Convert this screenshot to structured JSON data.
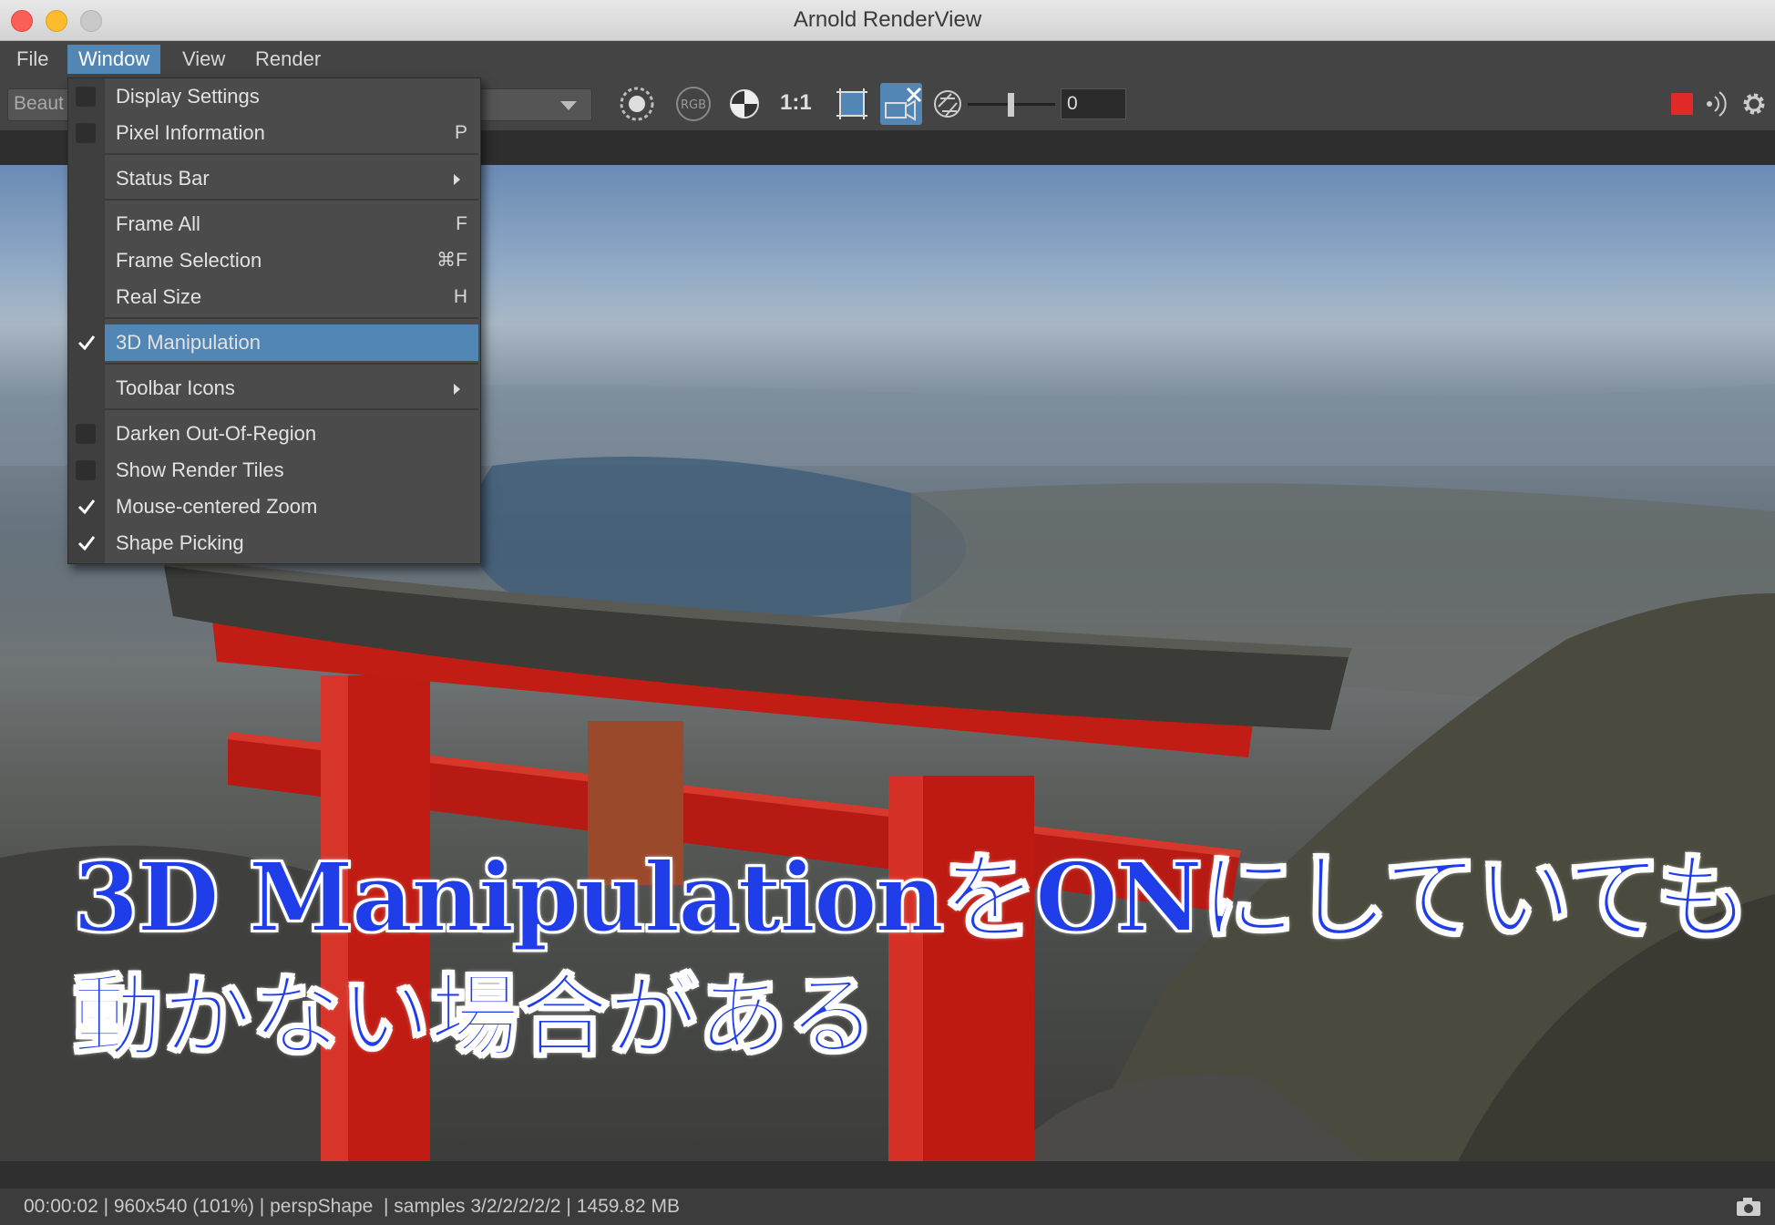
{
  "window": {
    "title": "Arnold RenderView"
  },
  "menubar": {
    "items": [
      "File",
      "Window",
      "View",
      "Render"
    ],
    "active": "Window"
  },
  "toolbar": {
    "aov_value": "Beaut",
    "one_to_one": "1:1",
    "frame_value": "0",
    "rgb_label": "RGB"
  },
  "dropdown": {
    "display_settings": "Display Settings",
    "pixel_information": "Pixel Information",
    "pixel_information_shortcut": "P",
    "status_bar": "Status Bar",
    "frame_all": "Frame All",
    "frame_all_shortcut": "F",
    "frame_selection": "Frame Selection",
    "frame_selection_shortcut": "⌘F",
    "real_size": "Real Size",
    "real_size_shortcut": "H",
    "manipulation_3d": "3D Manipulation",
    "toolbar_icons": "Toolbar Icons",
    "darken_out_of_region": "Darken Out-Of-Region",
    "show_render_tiles": "Show Render Tiles",
    "mouse_centered_zoom": "Mouse-centered Zoom",
    "shape_picking": "Shape Picking"
  },
  "overlay": {
    "line1": "3D ManipulationをONにしていても",
    "line2": "動かない場合がある"
  },
  "statusbar": {
    "text": "00:00:02 | 960x540 (101%) | perspShape  | samples 3/2/2/2/2/2 | 1459.82 MB"
  },
  "colors": {
    "accent": "#5286b5",
    "overlay_text": "#1f3de8",
    "torii_red": "#c81d14",
    "stop": "#e02a2a"
  }
}
